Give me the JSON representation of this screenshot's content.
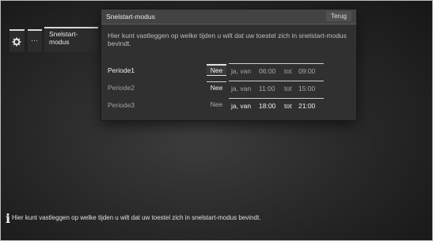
{
  "menu": {
    "gear_icon": "gear-icon",
    "more_label": "···",
    "snelstart_label": "Snelstart-\nmodus"
  },
  "dialog": {
    "title": "Snelstart-modus",
    "back_label": "Terug",
    "description": "Hier kunt vastleggen op welke tijden u wilt dat uw toestel zich in snelstart-modus bevindt.",
    "periods": [
      {
        "label": "Periode1",
        "nee": "Nee",
        "jv": "ja, van",
        "from": "06:00",
        "tot": "tot",
        "to": "09:00"
      },
      {
        "label": "Periode2",
        "nee": "Nee",
        "jv": "ja, van",
        "from": "11:00",
        "tot": "tot",
        "to": "15:00"
      },
      {
        "label": "Periode3",
        "nee": "Nee",
        "jv": "ja, van",
        "from": "18:00",
        "tot": "tot",
        "to": "21:00"
      }
    ]
  },
  "info": {
    "icon": "info-icon",
    "text": "Hier kunt vastleggen op welke tijden u wilt dat uw toestel zich in snelstart-modus bevindt."
  }
}
